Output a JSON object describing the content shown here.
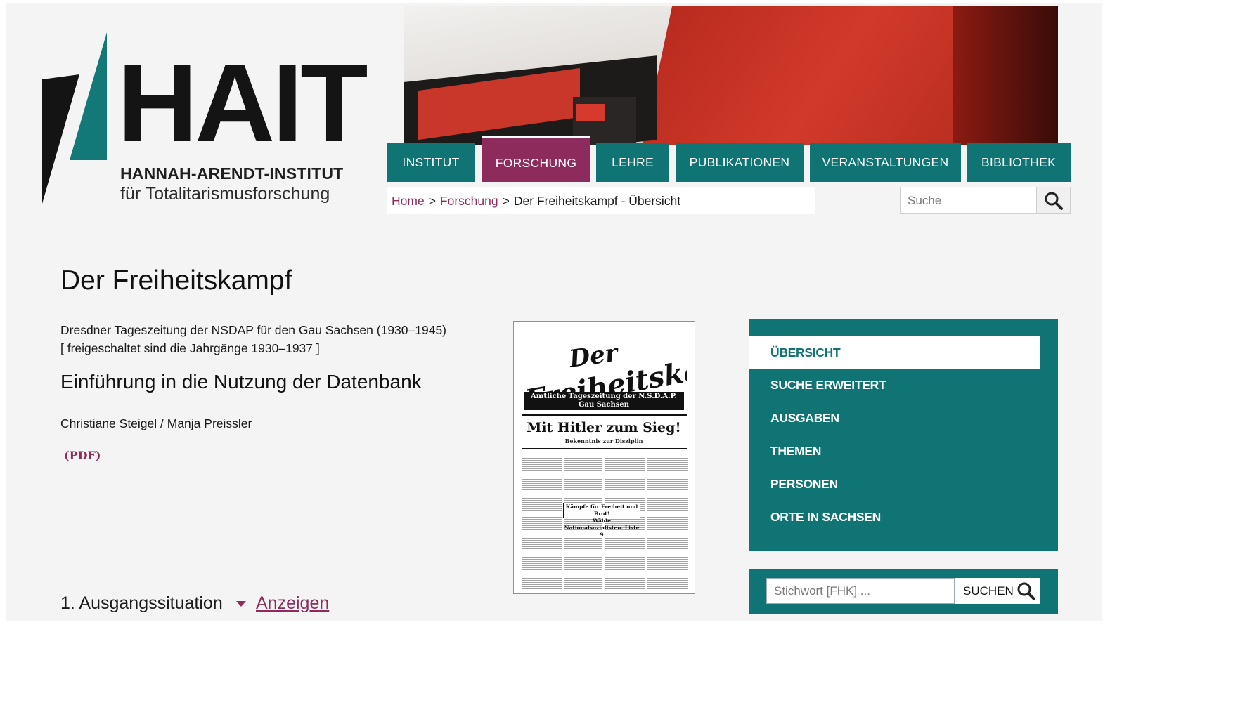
{
  "logo": {
    "wordmark": "HAIT",
    "line1": "HANNAH-ARENDT-INSTITUT",
    "line2": "für Totalitarismusforschung"
  },
  "nav": {
    "items": [
      {
        "label": "INSTITUT",
        "active": false
      },
      {
        "label": "FORSCHUNG",
        "active": true
      },
      {
        "label": "LEHRE",
        "active": false
      },
      {
        "label": "PUBLIKATIONEN",
        "active": false
      },
      {
        "label": "VERANSTALTUNGEN",
        "active": false
      },
      {
        "label": "BIBLIOTHEK",
        "active": false
      }
    ]
  },
  "breadcrumb": {
    "home": "Home",
    "sep1": ">",
    "section": "Forschung",
    "sep2": ">",
    "current": "Der Freiheitskampf - Übersicht"
  },
  "search": {
    "placeholder": "Suche",
    "icon": "search-icon"
  },
  "main": {
    "title": "Der Freiheitskampf",
    "subtitle_line1": "Dresdner Tageszeitung der NSDAP für den Gau Sachsen (1930–1945)",
    "subtitle_line2": "[ freigeschaltet sind die Jahrgänge 1930–1937 ]",
    "heading": "Einführung in die Nutzung der Datenbank",
    "authors": "Christiane Steigel / Manja Preissler",
    "pdf_link": "(PDF)",
    "section_title": "1. Ausgangssituation",
    "show_link": "Anzeigen"
  },
  "newspaper": {
    "band_line1": "Amtliche Tageszeitung der N.S.D.A.P.",
    "band_line2": "Gau Sachsen",
    "headline": "Mit Hitler zum Sieg!",
    "subhead": "Bekenntnis zur Disziplin",
    "box_line1": "Kämpfe für Freiheit und Brot!",
    "box_line2": "Wähle Nationalsozialisten. Liste 9"
  },
  "sidebar": {
    "items": [
      {
        "label": "ÜBERSICHT",
        "active": true
      },
      {
        "label": "SUCHE ERWEITERT",
        "active": false
      },
      {
        "label": "AUSGABEN",
        "active": false
      },
      {
        "label": "THEMEN",
        "active": false
      },
      {
        "label": "PERSONEN",
        "active": false
      },
      {
        "label": "ORTE IN SACHSEN",
        "active": false
      }
    ]
  },
  "keyword_search": {
    "placeholder": "Stichwort [FHK] ...",
    "button_label": "SUCHEN"
  },
  "colors": {
    "teal": "#107474",
    "plum": "#8d2c5c",
    "background": "#f4f4f4"
  }
}
